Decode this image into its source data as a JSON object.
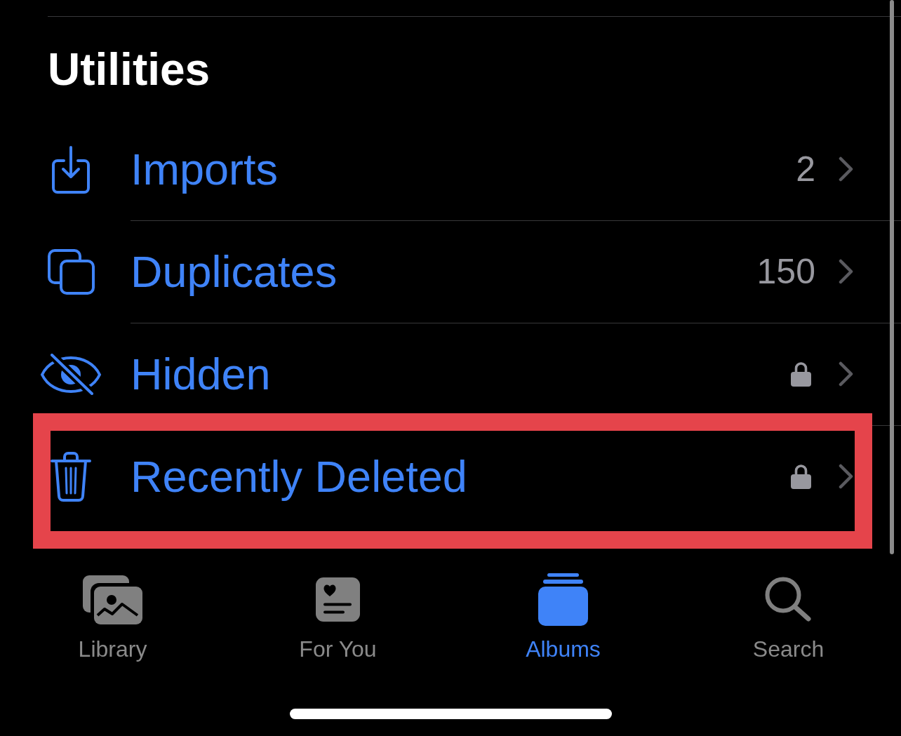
{
  "section": {
    "title": "Utilities"
  },
  "rows": [
    {
      "label": "Imports",
      "count": "2",
      "locked": false,
      "highlighted": false
    },
    {
      "label": "Duplicates",
      "count": "150",
      "locked": false,
      "highlighted": false
    },
    {
      "label": "Hidden",
      "locked": true,
      "highlighted": false
    },
    {
      "label": "Recently Deleted",
      "locked": true,
      "highlighted": true
    }
  ],
  "tabs": [
    {
      "label": "Library",
      "selected": false
    },
    {
      "label": "For You",
      "selected": false
    },
    {
      "label": "Albums",
      "selected": true
    },
    {
      "label": "Search",
      "selected": false
    }
  ]
}
